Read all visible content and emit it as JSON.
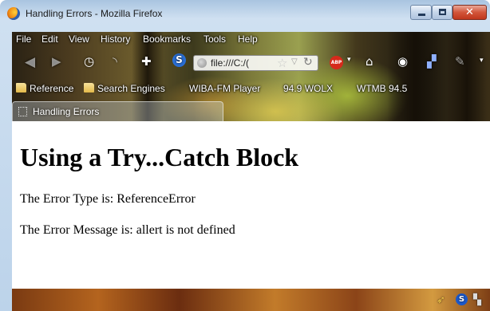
{
  "window": {
    "title": "Handling Errors - Mozilla Firefox",
    "close_glyph": "✕"
  },
  "menu": [
    "File",
    "Edit",
    "View",
    "History",
    "Bookmarks",
    "Tools",
    "Help"
  ],
  "toolbar": {
    "url": "file:///C:/("
  },
  "bookmarks": [
    "Reference",
    "Search Engines",
    "WIBA-FM Player",
    "94.9 WOLX",
    "WTMB 94.5"
  ],
  "tabs": [
    {
      "label": "Handling Errors"
    }
  ],
  "page": {
    "heading": "Using a Try...Catch Block",
    "error_type_line": "The Error Type is: ReferenceError",
    "error_message_line": "The Error Message is: allert is not defined"
  },
  "colors": {
    "titlebar": "#bcd3ea",
    "abp": "#d62a1b",
    "page_bg": "#ffffff"
  },
  "icons": {
    "back": "back-arrow-icon",
    "forward": "forward-arrow-icon",
    "history": "clock-icon",
    "rss": "rss-icon",
    "addon": "puzzle-icon",
    "skype": "s-icon",
    "home": "home-icon",
    "eye": "eye-icon",
    "ghost": "ghost-icon",
    "abp": "adblock-icon"
  }
}
